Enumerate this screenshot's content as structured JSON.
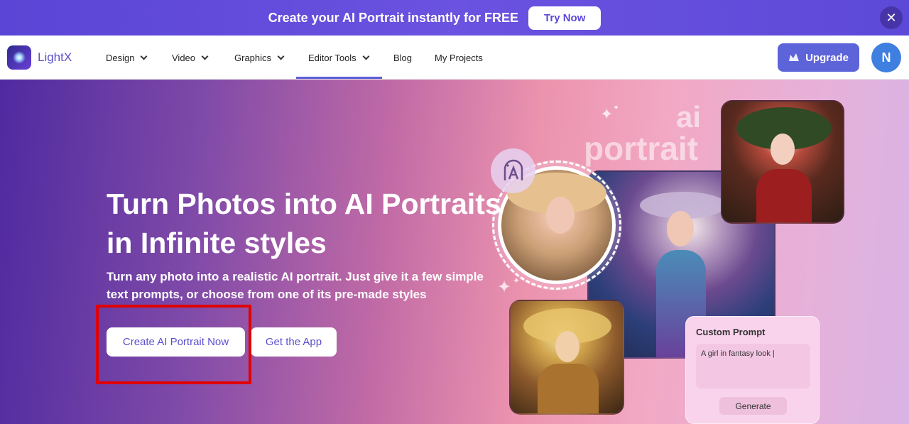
{
  "promo": {
    "text": "Create your AI Portrait instantly for FREE",
    "button": "Try Now",
    "close_icon": "close-icon"
  },
  "nav": {
    "logo_text": "LightX",
    "items": [
      {
        "label": "Design",
        "dropdown": true
      },
      {
        "label": "Video",
        "dropdown": true
      },
      {
        "label": "Graphics",
        "dropdown": true
      },
      {
        "label": "Editor Tools",
        "dropdown": true,
        "active": true
      },
      {
        "label": "Blog",
        "dropdown": false
      },
      {
        "label": "My Projects",
        "dropdown": false
      }
    ],
    "upgrade_label": "Upgrade",
    "avatar_initial": "N"
  },
  "hero": {
    "title": "Turn Photos into AI Portraits in Infinite styles",
    "subtitle": "Turn any photo into a realistic AI portrait. Just give it a few simple text prompts, or choose from one of its pre-made styles",
    "primary_button": "Create AI Portrait Now",
    "secondary_button": "Get the App"
  },
  "collage": {
    "watermark_line1": "ai",
    "watermark_line2": "portrait",
    "prompt_card": {
      "title": "Custom Prompt",
      "input_value": "A girl in fantasy look |",
      "button": "Generate"
    }
  },
  "colors": {
    "brand": "#5d63d9",
    "promo_bg": "#5a45d6",
    "highlight": "#e10000"
  }
}
